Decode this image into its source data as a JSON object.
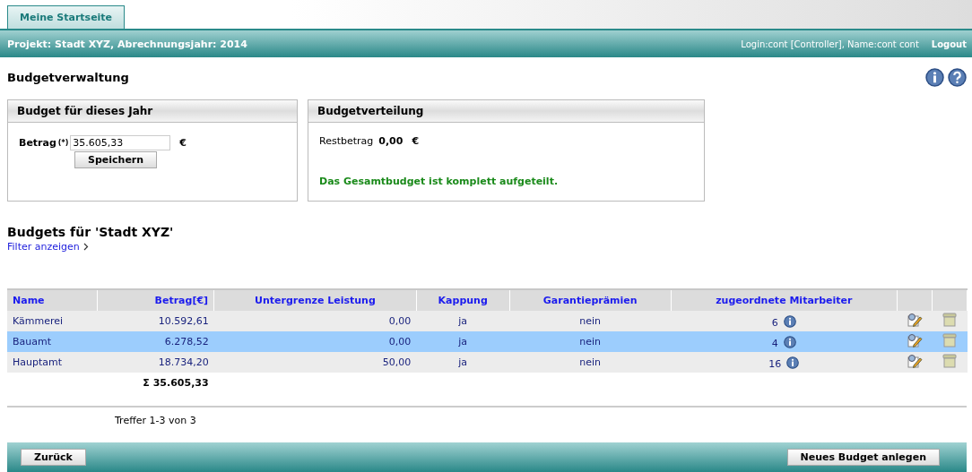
{
  "tabs": [
    {
      "label": "Meine Startseite",
      "selected": true
    }
  ],
  "header": {
    "project": "Projekt: Stadt XYZ, Abrechnungsjahr: 2014",
    "user": "Login:cont [Controller], Name:cont cont",
    "logout": "Logout"
  },
  "page_title": "Budgetverwaltung",
  "budget_panel": {
    "title": "Budget für dieses Jahr",
    "label": "Betrag",
    "required_mark": "(*)",
    "value": "35.605,33",
    "currency": "€",
    "save": "Speichern"
  },
  "distribution_panel": {
    "title": "Budgetverteilung",
    "label": "Restbetrag",
    "amount": "0,00",
    "currency": "€",
    "message": "Das Gesamtbudget ist komplett aufgeteilt."
  },
  "section_title": "Budgets für 'Stadt XYZ'",
  "filter_link": "Filter anzeigen",
  "table": {
    "columns": [
      "Name",
      "Betrag[€]",
      "Untergrenze Leistung",
      "Kappung",
      "Garantieprämien",
      "zugeordnete Mitarbeiter"
    ],
    "rows": [
      {
        "name": "Kämmerei",
        "amount": "10.592,61",
        "lower_limit": "0,00",
        "capping": "ja",
        "guarantee": "nein",
        "staff": "6",
        "selected": false
      },
      {
        "name": "Bauamt",
        "amount": "6.278,52",
        "lower_limit": "0,00",
        "capping": "ja",
        "guarantee": "nein",
        "staff": "4",
        "selected": true
      },
      {
        "name": "Hauptamt",
        "amount": "18.734,20",
        "lower_limit": "50,00",
        "capping": "ja",
        "guarantee": "nein",
        "staff": "16",
        "selected": false
      }
    ],
    "total": "Σ 35.605,33",
    "hits": "Treffer 1-3 von 3"
  },
  "footer": {
    "back": "Zurück",
    "new": "Neues Budget anlegen"
  }
}
